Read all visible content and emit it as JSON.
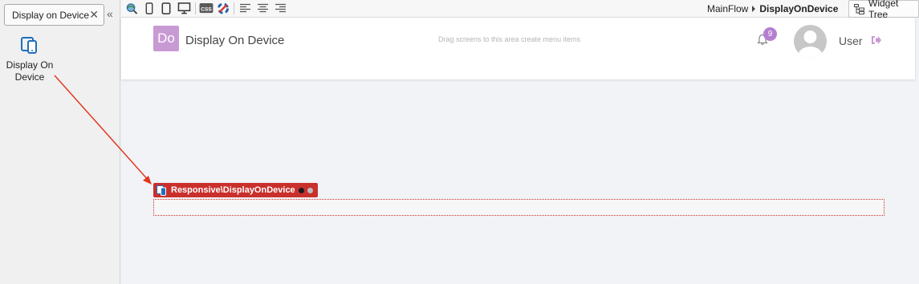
{
  "left_panel": {
    "search_tab": {
      "label": "Display on Device",
      "close_glyph": "✕"
    },
    "collapse_glyph": "«",
    "widget": {
      "label": "Display On Device",
      "icon": "device-icon"
    }
  },
  "toolbar": {
    "icons": [
      "preview-icon",
      "phone-icon",
      "tablet-icon",
      "desktop-icon",
      "css-icon",
      "theme-icon",
      "align-left-icon",
      "align-center-icon",
      "align-right-icon"
    ],
    "breadcrumb": {
      "flow": "MainFlow",
      "screen": "DisplayOnDevice"
    },
    "widget_tree_label": "Widget Tree"
  },
  "canvas": {
    "header": {
      "logo_text": "Do",
      "app_name": "Display On Device",
      "drag_hint": "Drag screens to this area create menu items",
      "notification_count": "9",
      "user_label": "User"
    },
    "block": {
      "label": "Responsive\\DisplayOnDevice"
    }
  },
  "colors": {
    "accent_purple": "#c89ad4",
    "block_red": "#c9302c",
    "arrow_red": "#e03a1e"
  }
}
